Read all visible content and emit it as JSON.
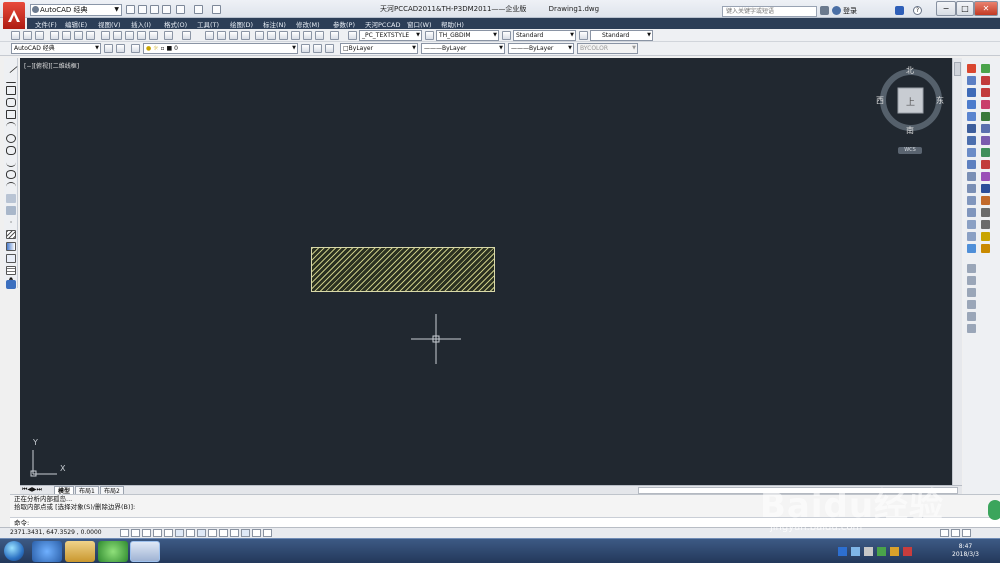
{
  "window": {
    "workspace": "AutoCAD 经典",
    "title": "天河PCCAD2011&TH-P3DM2011——企业版",
    "document": "Drawing1.dwg",
    "search_placeholder": "键入关键字或短语",
    "login": "登录",
    "controls": [
      "−",
      "□",
      "✕"
    ]
  },
  "menu": [
    "文件(F)",
    "编辑(E)",
    "视图(V)",
    "插入(I)",
    "格式(O)",
    "工具(T)",
    "绘图(D)",
    "标注(N)",
    "修改(M)",
    "参数(P)",
    "天河PCCAD",
    "窗口(W)",
    "帮助(H)"
  ],
  "toolbar1": {
    "text_style": "_PC_TEXTSTYLE",
    "dim_style": "TH_GBDIM",
    "table_style": "Standard",
    "mleader_style": "Standard"
  },
  "toolbar2": {
    "workspace": "AutoCAD 经典",
    "layer": "0",
    "color": "ByLayer",
    "linetype": "ByLayer",
    "lineweight": "ByLayer",
    "plotstyle": "BYCOLOR"
  },
  "viewport": {
    "label": "[−][俯视][二维线框]",
    "viewcube": {
      "north": "北",
      "south": "南",
      "east": "东",
      "west": "西",
      "face": "上",
      "wcs": "WCS"
    },
    "ucs": {
      "x": "X",
      "y": "Y"
    },
    "colors": {
      "background": "#212830",
      "hatch": "#c6c784"
    }
  },
  "tabs": [
    "模型",
    "布局1",
    "布局2"
  ],
  "command": {
    "history": [
      "正在分析内部孤岛...",
      "拾取内部点或 [选择对象(S)/删除边界(B)]:"
    ],
    "prompt": "命令:"
  },
  "status": {
    "coords": "2371.3431, 647.3529 , 0.0000"
  },
  "taskbar": {
    "time": "8:47",
    "date": "2018/3/3"
  },
  "watermark": {
    "brand": "Baidu经验",
    "url": "jingyan.baidu.com"
  }
}
